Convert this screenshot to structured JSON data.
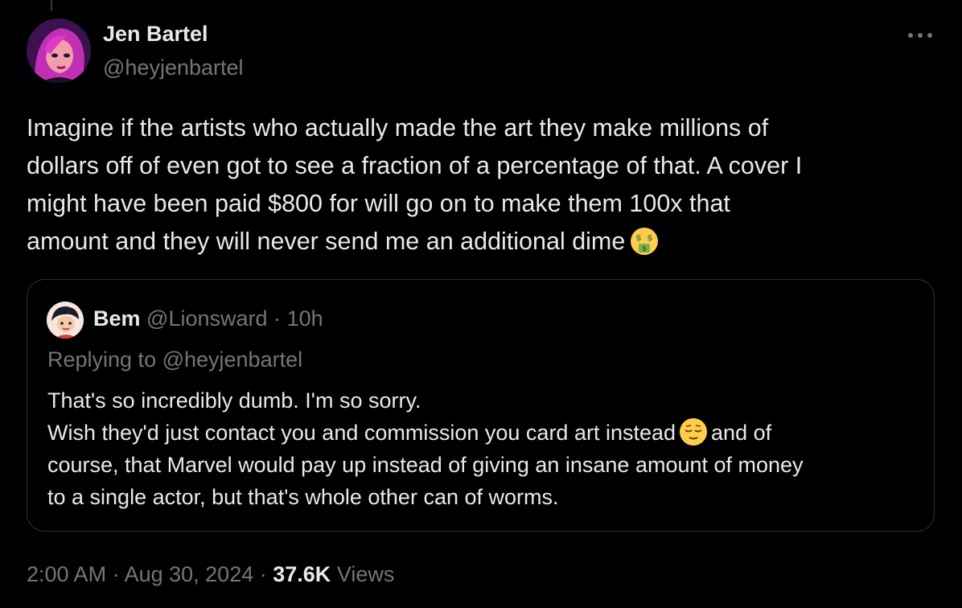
{
  "author": {
    "name": "Jen Bartel",
    "handle": "@heyjenbartel",
    "avatar_icon": "avatar-illustrated-woman-pink-hair"
  },
  "tweet": {
    "lines": [
      "Imagine if the artists who actually made the art they make millions of",
      "dollars off of even got to see a fraction of a percentage of that. A cover I",
      "might have been paid $800 for will go on to make them 100x that",
      "amount and they will never send me an additional dime"
    ],
    "emoji": "money-mouth-face-icon"
  },
  "quote": {
    "name": "Bem",
    "handle": "@Lionsward",
    "separator": "·",
    "time": "10h",
    "replying_to": "Replying to @heyjenbartel",
    "line1": "That's so incredibly dumb. I'm so sorry.",
    "line2_before": "Wish they'd just contact you and commission you card art instead",
    "line2_after": "and of",
    "line3": "course, that Marvel would pay up instead of giving an insane amount of money",
    "line4": "to a single actor, but that's whole other can of worms.",
    "emoji": "relieved-face-icon"
  },
  "meta": {
    "time": "2:00 AM",
    "sep1": " · ",
    "date": "Aug 30, 2024",
    "sep2": " · ",
    "views_count": "37.6K",
    "views_label": "Views"
  },
  "colors": {
    "background": "#000000",
    "text_primary": "#e7e9ea",
    "text_secondary": "#71767b",
    "border": "#2f3336"
  }
}
